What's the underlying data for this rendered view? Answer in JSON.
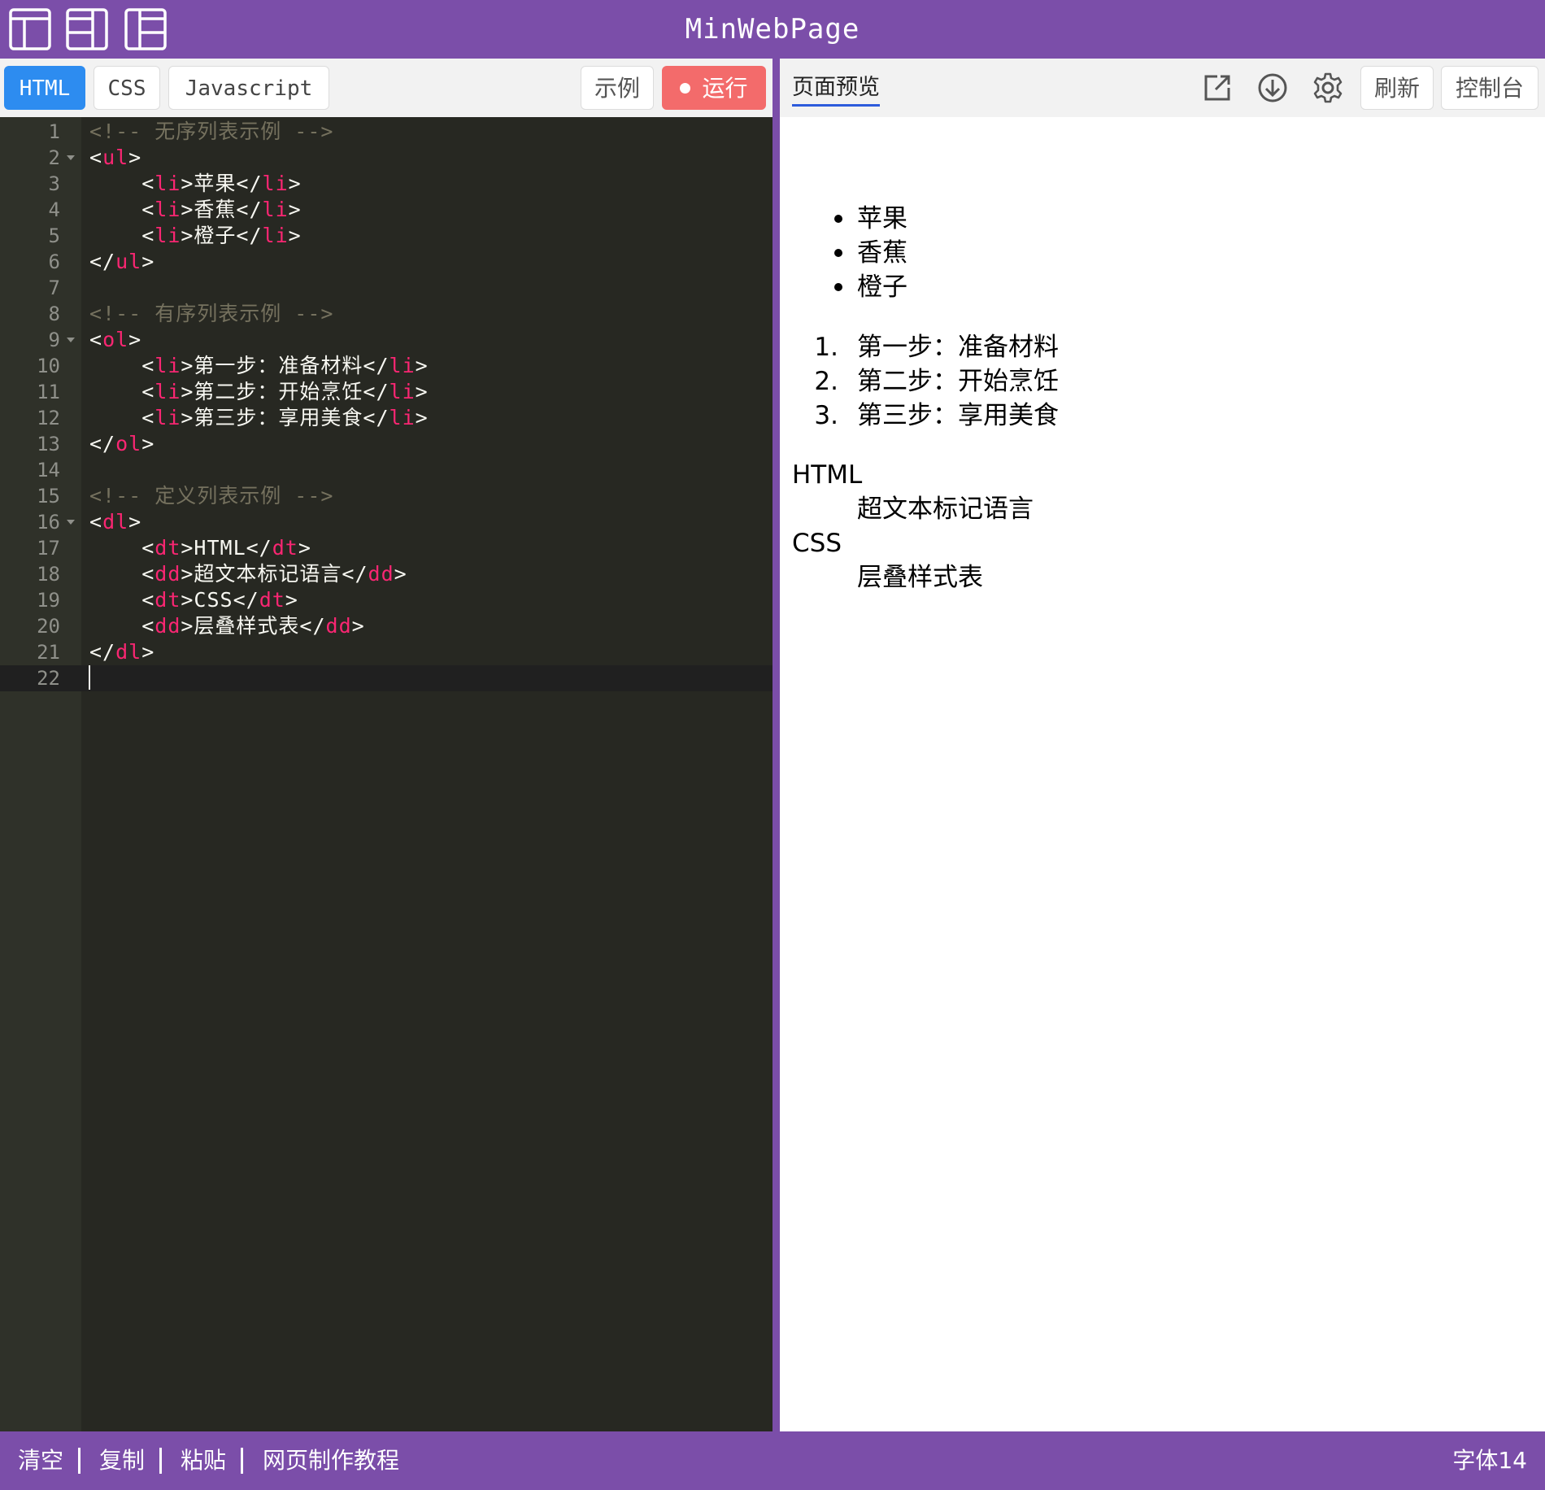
{
  "app": {
    "title": "MinWebPage",
    "layout_buttons": [
      "layout-single-icon",
      "layout-split-icon",
      "layout-sidebar-icon"
    ]
  },
  "editor": {
    "tabs": [
      "HTML",
      "CSS",
      "Javascript"
    ],
    "active_tab": "HTML",
    "example_label": "示例",
    "run_label": "运行",
    "lines": [
      {
        "n": "1",
        "fold": false,
        "tokens": [
          [
            "c",
            "<!-- 无序列表示例 -->"
          ]
        ]
      },
      {
        "n": "2",
        "fold": true,
        "tokens": [
          [
            "p",
            "<"
          ],
          [
            "t",
            "ul"
          ],
          [
            "p",
            ">"
          ]
        ]
      },
      {
        "n": "3",
        "fold": false,
        "tokens": [
          [
            "p",
            "    <"
          ],
          [
            "t",
            "li"
          ],
          [
            "p",
            ">苹果</"
          ],
          [
            "t",
            "li"
          ],
          [
            "p",
            ">"
          ]
        ]
      },
      {
        "n": "4",
        "fold": false,
        "tokens": [
          [
            "p",
            "    <"
          ],
          [
            "t",
            "li"
          ],
          [
            "p",
            ">香蕉</"
          ],
          [
            "t",
            "li"
          ],
          [
            "p",
            ">"
          ]
        ]
      },
      {
        "n": "5",
        "fold": false,
        "tokens": [
          [
            "p",
            "    <"
          ],
          [
            "t",
            "li"
          ],
          [
            "p",
            ">橙子</"
          ],
          [
            "t",
            "li"
          ],
          [
            "p",
            ">"
          ]
        ]
      },
      {
        "n": "6",
        "fold": false,
        "tokens": [
          [
            "p",
            "</"
          ],
          [
            "t",
            "ul"
          ],
          [
            "p",
            ">"
          ]
        ]
      },
      {
        "n": "7",
        "fold": false,
        "tokens": []
      },
      {
        "n": "8",
        "fold": false,
        "tokens": [
          [
            "c",
            "<!-- 有序列表示例 -->"
          ]
        ]
      },
      {
        "n": "9",
        "fold": true,
        "tokens": [
          [
            "p",
            "<"
          ],
          [
            "t",
            "ol"
          ],
          [
            "p",
            ">"
          ]
        ]
      },
      {
        "n": "10",
        "fold": false,
        "tokens": [
          [
            "p",
            "    <"
          ],
          [
            "t",
            "li"
          ],
          [
            "p",
            ">第一步：准备材料</"
          ],
          [
            "t",
            "li"
          ],
          [
            "p",
            ">"
          ]
        ]
      },
      {
        "n": "11",
        "fold": false,
        "tokens": [
          [
            "p",
            "    <"
          ],
          [
            "t",
            "li"
          ],
          [
            "p",
            ">第二步：开始烹饪</"
          ],
          [
            "t",
            "li"
          ],
          [
            "p",
            ">"
          ]
        ]
      },
      {
        "n": "12",
        "fold": false,
        "tokens": [
          [
            "p",
            "    <"
          ],
          [
            "t",
            "li"
          ],
          [
            "p",
            ">第三步：享用美食</"
          ],
          [
            "t",
            "li"
          ],
          [
            "p",
            ">"
          ]
        ]
      },
      {
        "n": "13",
        "fold": false,
        "tokens": [
          [
            "p",
            "</"
          ],
          [
            "t",
            "ol"
          ],
          [
            "p",
            ">"
          ]
        ]
      },
      {
        "n": "14",
        "fold": false,
        "tokens": []
      },
      {
        "n": "15",
        "fold": false,
        "tokens": [
          [
            "c",
            "<!-- 定义列表示例 -->"
          ]
        ]
      },
      {
        "n": "16",
        "fold": true,
        "tokens": [
          [
            "p",
            "<"
          ],
          [
            "t",
            "dl"
          ],
          [
            "p",
            ">"
          ]
        ]
      },
      {
        "n": "17",
        "fold": false,
        "tokens": [
          [
            "p",
            "    <"
          ],
          [
            "t",
            "dt"
          ],
          [
            "p",
            ">HTML</"
          ],
          [
            "t",
            "dt"
          ],
          [
            "p",
            ">"
          ]
        ]
      },
      {
        "n": "18",
        "fold": false,
        "tokens": [
          [
            "p",
            "    <"
          ],
          [
            "t",
            "dd"
          ],
          [
            "p",
            ">超文本标记语言</"
          ],
          [
            "t",
            "dd"
          ],
          [
            "p",
            ">"
          ]
        ]
      },
      {
        "n": "19",
        "fold": false,
        "tokens": [
          [
            "p",
            "    <"
          ],
          [
            "t",
            "dt"
          ],
          [
            "p",
            ">CSS</"
          ],
          [
            "t",
            "dt"
          ],
          [
            "p",
            ">"
          ]
        ]
      },
      {
        "n": "20",
        "fold": false,
        "tokens": [
          [
            "p",
            "    <"
          ],
          [
            "t",
            "dd"
          ],
          [
            "p",
            ">层叠样式表</"
          ],
          [
            "t",
            "dd"
          ],
          [
            "p",
            ">"
          ]
        ]
      },
      {
        "n": "21",
        "fold": false,
        "tokens": [
          [
            "p",
            "</"
          ],
          [
            "t",
            "dl"
          ],
          [
            "p",
            ">"
          ]
        ]
      },
      {
        "n": "22",
        "fold": false,
        "tokens": []
      }
    ],
    "active_line": "22",
    "colors": {
      "comment": "#75715e",
      "tag": "#f92672",
      "text": "#f8f8f2",
      "background": "#272822"
    }
  },
  "preview": {
    "tab_label": "页面预览",
    "icons": [
      "open-external-icon",
      "download-icon",
      "settings-icon"
    ],
    "refresh_label": "刷新",
    "console_label": "控制台",
    "unordered_list": [
      "苹果",
      "香蕉",
      "橙子"
    ],
    "ordered_list": [
      {
        "num": "1.",
        "text": "第一步：准备材料"
      },
      {
        "num": "2.",
        "text": "第二步：开始烹饪"
      },
      {
        "num": "3.",
        "text": "第三步：享用美食"
      }
    ],
    "definition_list": [
      {
        "term": "HTML",
        "desc": "超文本标记语言"
      },
      {
        "term": "CSS",
        "desc": "层叠样式表"
      }
    ]
  },
  "statusbar": {
    "links": [
      "清空",
      "复制",
      "粘贴",
      "网页制作教程"
    ],
    "font_label": "字体14"
  },
  "theme": {
    "accent": "#7b4ea9",
    "tab_active": "#2d8cf0",
    "run": "#f36b6b"
  }
}
